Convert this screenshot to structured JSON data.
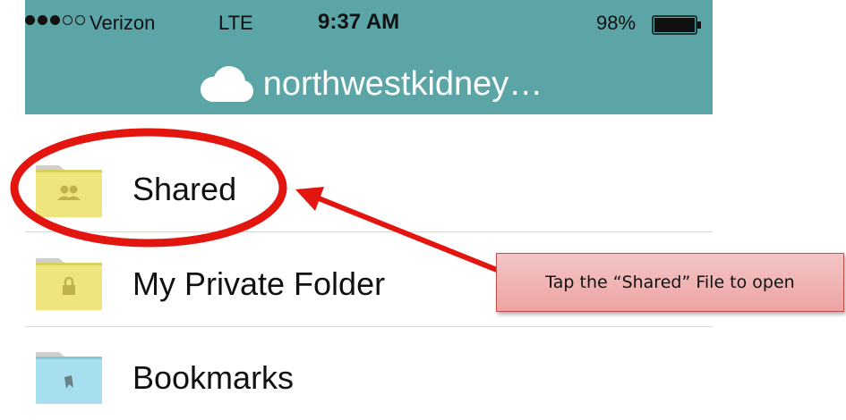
{
  "status_bar": {
    "carrier": "Verizon",
    "network": "LTE",
    "time": "9:37 AM",
    "battery_percent": "98%",
    "signal_bars_filled": 3,
    "signal_bars_total": 5
  },
  "header": {
    "title": "northwestkidney…",
    "icon": "cloud-icon",
    "background_color": "#5ba5a6"
  },
  "folders": [
    {
      "label": "Shared",
      "icon": "shared-folder-icon",
      "color": "#eee57e"
    },
    {
      "label": "My Private Folder",
      "icon": "private-folder-icon",
      "color": "#eee57e"
    },
    {
      "label": "Bookmarks",
      "icon": "bookmarks-folder-icon",
      "color": "#a7dfee"
    }
  ],
  "annotation": {
    "text": "Tap the “Shared” File to open",
    "highlight_color": "#e3150f"
  }
}
